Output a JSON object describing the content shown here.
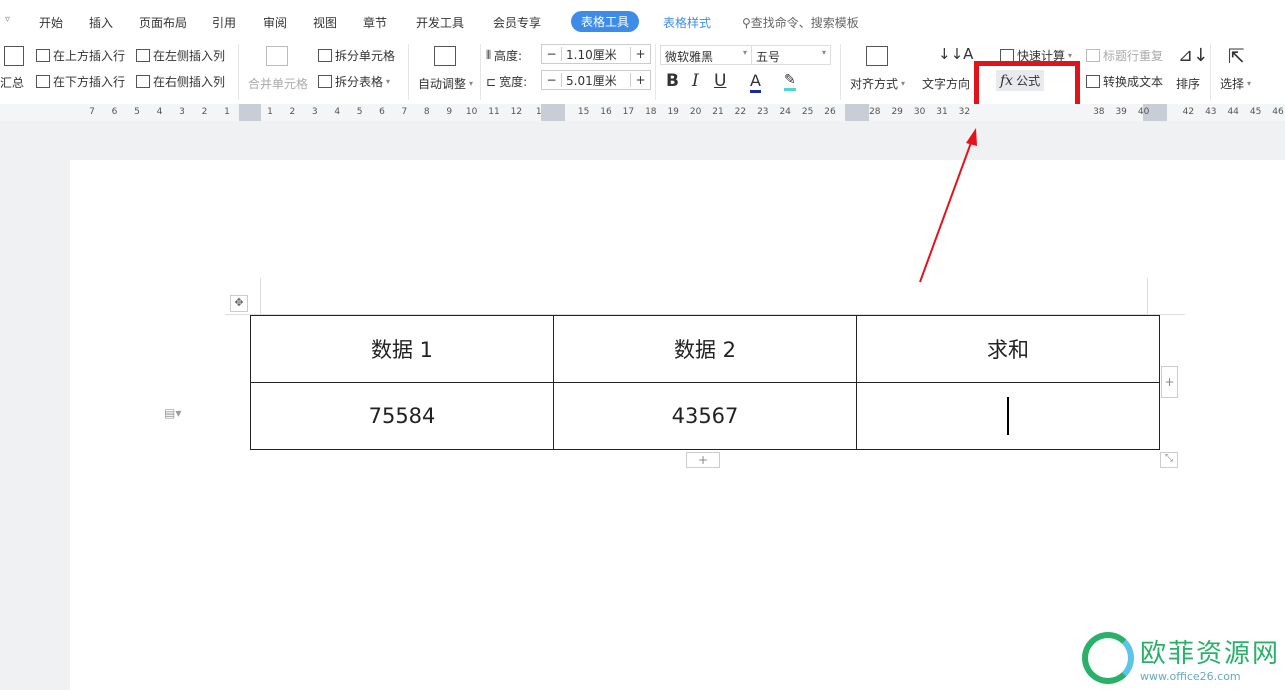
{
  "tabs": [
    "开始",
    "插入",
    "页面布局",
    "引用",
    "审阅",
    "视图",
    "章节",
    "开发工具",
    "会员专享",
    "表格工具",
    "表格样式"
  ],
  "search_placeholder": "查找命令、搜索模板",
  "ribbon": {
    "summary": "汇总",
    "insert_above": "在上方插入行",
    "insert_below": "在下方插入行",
    "insert_left": "在左侧插入列",
    "insert_right": "在右侧插入列",
    "merge_cells": "合并单元格",
    "split_cells": "拆分单元格",
    "split_table": "拆分表格",
    "auto_fit": "自动调整",
    "height_label": "高度:",
    "height_value": "1.10厘米",
    "width_label": "宽度:",
    "width_value": "5.01厘米",
    "font": "微软雅黑",
    "font_size": "五号",
    "bold": "B",
    "italic": "I",
    "underline": "U",
    "font_color": "A",
    "align": "对齐方式",
    "text_direction": "文字方向",
    "quick_calc": "快速计算",
    "formula": "公式",
    "formula_icon": "fx",
    "repeat_header": "标题行重复",
    "to_text": "转换成文本",
    "sort": "排序",
    "select": "选择"
  },
  "ruler": {
    "left": [
      "7",
      "6",
      "5",
      "4",
      "3",
      "2",
      "1"
    ],
    "right": [
      "1",
      "2",
      "3",
      "4",
      "5",
      "6",
      "7",
      "8",
      "9",
      "10",
      "11",
      "12",
      "1",
      "",
      "15",
      "16",
      "17",
      "18",
      "19",
      "20",
      "21",
      "22",
      "23",
      "24",
      "25",
      "26",
      "",
      "28",
      "29",
      "30",
      "31",
      "32",
      "",
      "",
      "",
      "",
      "",
      "38",
      "39",
      "40",
      "",
      "42",
      "43",
      "44",
      "45",
      "46"
    ]
  },
  "table": {
    "header": [
      "数据 1",
      "数据 2",
      "求和"
    ],
    "row": [
      "75584",
      "43567",
      ""
    ]
  },
  "watermark": {
    "name": "欧菲资源网",
    "url": "www.office26.com"
  },
  "colors": {
    "accent": "#3d8de8",
    "highlight": "#e3131b"
  }
}
